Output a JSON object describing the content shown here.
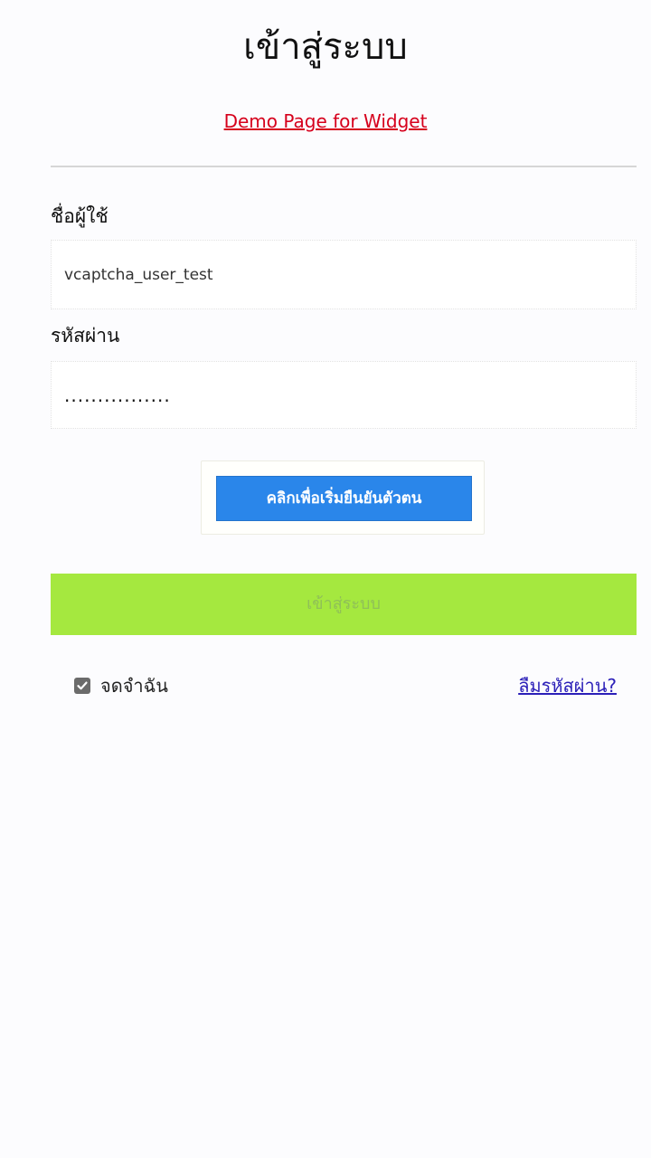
{
  "page": {
    "title": "เข้าสู่ระบบ",
    "demo_link": "Demo Page for Widget"
  },
  "form": {
    "username_label": "ชื่อผู้ใช้",
    "username_value": "vcaptcha_user_test",
    "password_label": "รหัสผ่าน",
    "password_value": "................",
    "captcha_button_label": "คลิกเพื่อเริ่มยืนยันตัวตน",
    "submit_label": "เข้าสู่ระบบ",
    "remember_label": "จดจำฉัน",
    "remember_checked": true,
    "forgot_label": "ลืมรหัสผ่าน?"
  },
  "colors": {
    "demo_link": "#d6001c",
    "captcha_button": "#2a86ea",
    "submit_button": "#a5e83f",
    "forgot_link": "#2b1fb8"
  },
  "icons": {
    "remember_checkbox": "checkmark-icon"
  }
}
